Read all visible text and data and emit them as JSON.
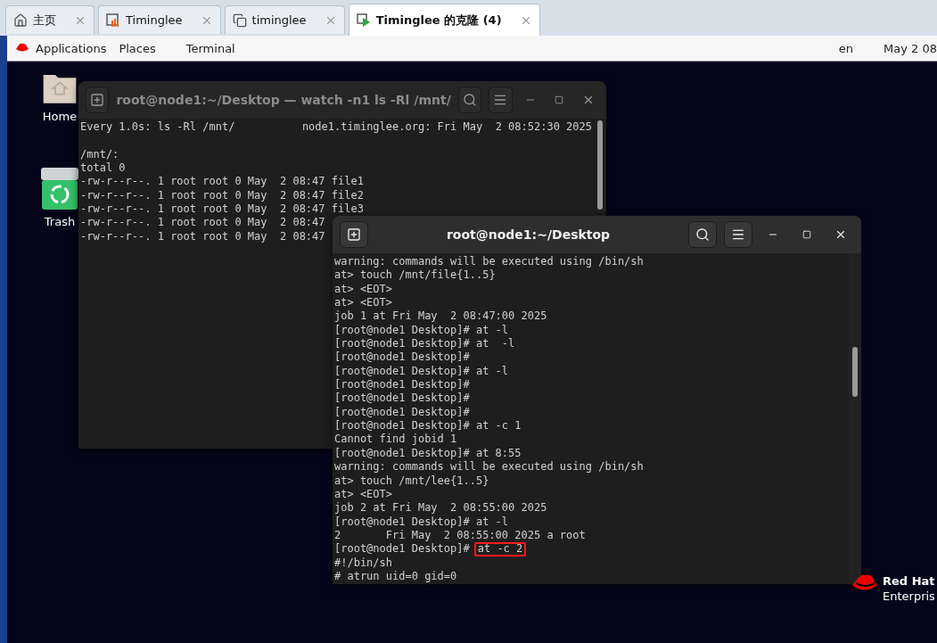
{
  "browser_tabs": [
    {
      "label": "主页",
      "kind": "home",
      "selected": false
    },
    {
      "label": "Timinglee",
      "kind": "vm",
      "selected": false
    },
    {
      "label": "timinglee",
      "kind": "copy",
      "selected": false
    },
    {
      "label": "Timinglee 的克隆 (4)",
      "kind": "run",
      "selected": true
    }
  ],
  "top_panel": {
    "menus": [
      "Applications",
      "Places",
      "Terminal"
    ],
    "language": "en",
    "clock": "May 2 08"
  },
  "desktop_icons": [
    {
      "label": "Home",
      "kind": "folder"
    },
    {
      "label": "Trash",
      "kind": "trash"
    }
  ],
  "windows": [
    {
      "title": "root@node1:~/Desktop — watch -n1 ls -Rl /mnt/",
      "active": false,
      "header": {
        "left": "Every 1.0s: ls -Rl /mnt/",
        "right": "node1.timinglee.org: Fri May  2 08:52:30 2025"
      },
      "lines": [
        {
          "text": "/mnt/:"
        },
        {
          "text": "total 0"
        },
        {
          "text": "-rw-r--r--. 1 root root 0 May  2 08:47 file1"
        },
        {
          "text": "-rw-r--r--. 1 root root 0 May  2 08:47 file2"
        },
        {
          "text": "-rw-r--r--. 1 root root 0 May  2 08:47 file3"
        },
        {
          "text": "-rw-r--r--. 1 root root 0 May  2 08:47"
        },
        {
          "text": "-rw-r--r--. 1 root root 0 May  2 08:47"
        }
      ]
    },
    {
      "title": "root@node1:~/Desktop",
      "active": true,
      "lines": [
        {
          "text": "warning: commands will be executed using /bin/sh"
        },
        {
          "text": "at> touch /mnt/file{1..5}"
        },
        {
          "text": "at> <EOT>"
        },
        {
          "text": "at> <EOT>"
        },
        {
          "text": "job 1 at Fri May  2 08:47:00 2025"
        },
        {
          "text": "[root@node1 Desktop]# at -l"
        },
        {
          "text": "[root@node1 Desktop]# at  -l"
        },
        {
          "text": "[root@node1 Desktop]#"
        },
        {
          "text": "[root@node1 Desktop]# at -l"
        },
        {
          "text": "[root@node1 Desktop]#"
        },
        {
          "text": "[root@node1 Desktop]#"
        },
        {
          "text": "[root@node1 Desktop]#"
        },
        {
          "text": "[root@node1 Desktop]# at -c 1"
        },
        {
          "text": "Cannot find jobid 1"
        },
        {
          "text": "[root@node1 Desktop]# at 8:55"
        },
        {
          "text": "warning: commands will be executed using /bin/sh"
        },
        {
          "text": "at> touch /mnt/lee{1..5}"
        },
        {
          "text": "at> <EOT>"
        },
        {
          "text": "job 2 at Fri May  2 08:55:00 2025"
        },
        {
          "text": "[root@node1 Desktop]# at -l"
        },
        {
          "text": "2       Fri May  2 08:55:00 2025 a root"
        },
        {
          "text": "[root@node1 Desktop]#",
          "command": "at -c 2",
          "highlighted": true
        },
        {
          "text": "#!/bin/sh"
        },
        {
          "text": "# atrun uid=0 gid=0"
        }
      ]
    }
  ],
  "brand": {
    "name": "Red Hat",
    "product": "Enterpris"
  }
}
